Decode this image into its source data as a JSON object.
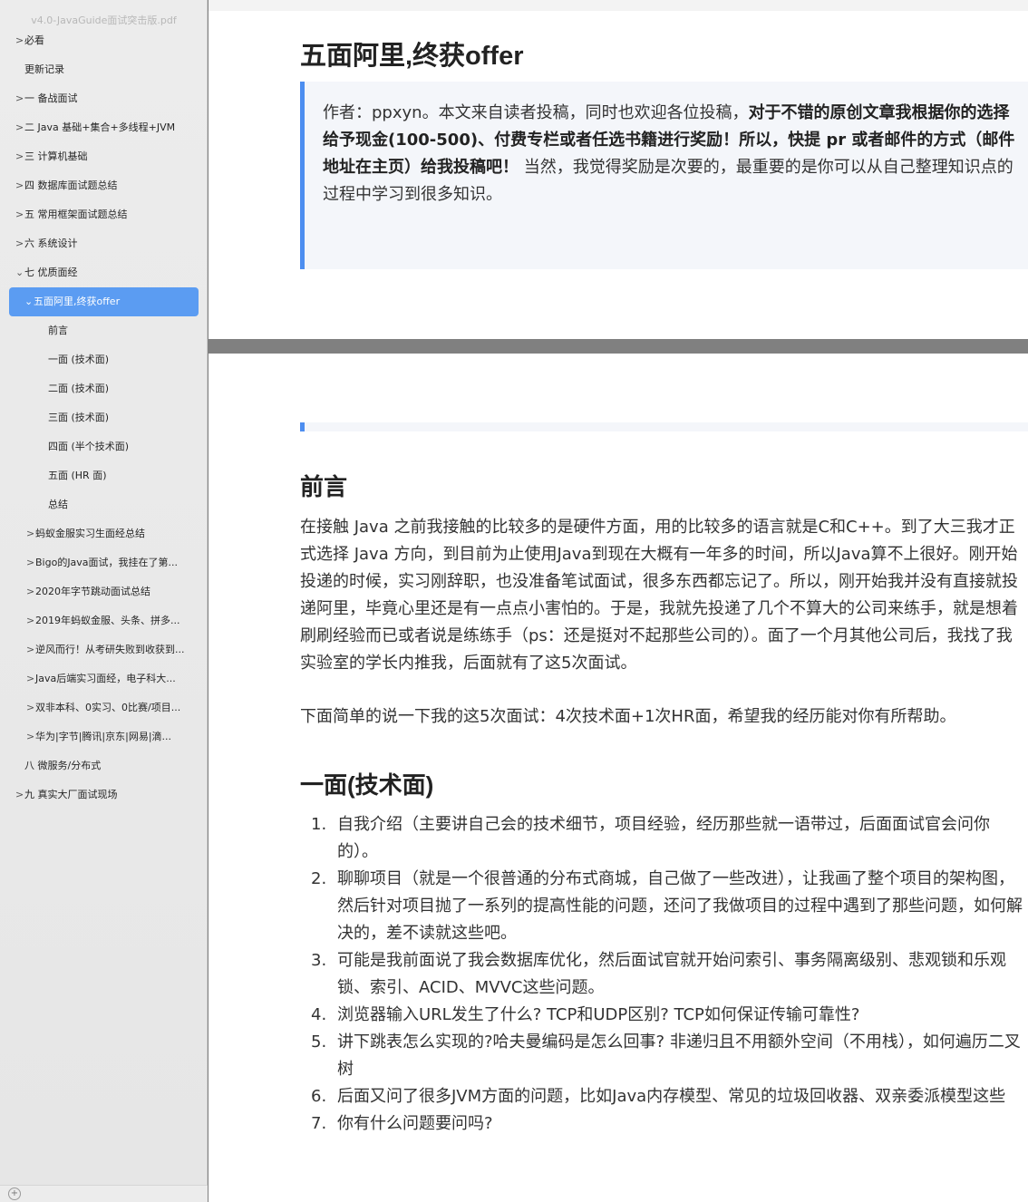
{
  "sidebar": {
    "title": "v4.0-JavaGuide面试突击版.pdf",
    "items": [
      {
        "label": "必看",
        "chevron": ">"
      },
      {
        "label": "更新记录",
        "chevron": ""
      },
      {
        "label": "一 备战面试",
        "chevron": ">"
      },
      {
        "label": "二 Java 基础+集合+多线程+JVM",
        "chevron": ">"
      },
      {
        "label": "三 计算机基础",
        "chevron": ">"
      },
      {
        "label": "四 数据库面试题总结",
        "chevron": ">"
      },
      {
        "label": "五 常用框架面试题总结",
        "chevron": ">"
      },
      {
        "label": "六 系统设计",
        "chevron": ">"
      },
      {
        "label": "七 优质面经",
        "chevron": "⌄"
      },
      {
        "label": "五面阿里,终获offer",
        "chevron": "⌄"
      },
      {
        "label": "前言",
        "chevron": ""
      },
      {
        "label": "一面 (技术面)",
        "chevron": ""
      },
      {
        "label": "二面 (技术面)",
        "chevron": ""
      },
      {
        "label": "三面 (技术面)",
        "chevron": ""
      },
      {
        "label": "四面 (半个技术面)",
        "chevron": ""
      },
      {
        "label": "五面 (HR 面)",
        "chevron": ""
      },
      {
        "label": "总结",
        "chevron": ""
      },
      {
        "label": "蚂蚁金服实习生面经总结",
        "chevron": ">"
      },
      {
        "label": "Bigo的Java面试，我挂在了第...",
        "chevron": ">"
      },
      {
        "label": "2020年字节跳动面试总结",
        "chevron": ">"
      },
      {
        "label": "2019年蚂蚁金服、头条、拼多...",
        "chevron": ">"
      },
      {
        "label": "逆风而行！从考研失败到收获到...",
        "chevron": ">"
      },
      {
        "label": "Java后端实习面经，电子科大...",
        "chevron": ">"
      },
      {
        "label": "双非本科、0实习、0比赛/项目...",
        "chevron": ">"
      },
      {
        "label": "华为|字节|腾讯|京东|网易|滴...",
        "chevron": ">"
      },
      {
        "label": "八 微服务/分布式",
        "chevron": ""
      },
      {
        "label": "九 真实大厂面试现场",
        "chevron": ">"
      }
    ]
  },
  "page1": {
    "title": "五面阿里,终获offer",
    "quote_plain1": "作者：ppxyn。本文来自读者投稿，同时也欢迎各位投稿，",
    "quote_bold": "对于不错的原创文章我根据你的选择给予现金(100-500)、付费专栏或者任选书籍进行奖励！所以，快提 pr 或者邮件的方式（邮件地址在主页）给我投稿吧！",
    "quote_plain2": " 当然，我觉得奖励是次要的，最重要的是你可以从自己整理知识点的过程中学习到很多知识。"
  },
  "page2": {
    "preface_heading": "前言",
    "preface_p1": "在接触 Java 之前我接触的比较多的是硬件方面，用的比较多的语言就是C和C++。到了大三我才正式选择 Java 方向，到目前为止使用Java到现在大概有一年多的时间，所以Java算不上很好。刚开始投递的时候，实习刚辞职，也没准备笔试面试，很多东西都忘记了。所以，刚开始我并没有直接就投递阿里，毕竟心里还是有一点点小害怕的。于是，我就先投递了几个不算大的公司来练手，就是想着刷刷经验而已或者说是练练手（ps：还是挺对不起那些公司的）。面了一个月其他公司后，我找了我实验室的学长内推我，后面就有了这5次面试。",
    "preface_p2": "下面简单的说一下我的这5次面试：4次技术面+1次HR面，希望我的经历能对你有所帮助。",
    "round1_heading": "一面(技术面)",
    "round1_items": [
      "自我介绍（主要讲自己会的技术细节，项目经验，经历那些就一语带过，后面面试官会问你的）。",
      "聊聊项目（就是一个很普通的分布式商城，自己做了一些改进），让我画了整个项目的架构图，然后针对项目抛了一系列的提高性能的问题，还问了我做项目的过程中遇到了那些问题，如何解决的，差不读就这些吧。",
      "可能是我前面说了我会数据库优化，然后面试官就开始问索引、事务隔离级别、悲观锁和乐观锁、索引、ACID、MVVC这些问题。",
      "浏览器输入URL发生了什么? TCP和UDP区别? TCP如何保证传输可靠性?",
      "讲下跳表怎么实现的?哈夫曼编码是怎么回事? 非递归且不用额外空间（不用栈），如何遍历二叉树",
      "后面又问了很多JVM方面的问题，比如Java内存模型、常见的垃圾回收器、双亲委派模型这些",
      "你有什么问题要问吗?"
    ]
  }
}
